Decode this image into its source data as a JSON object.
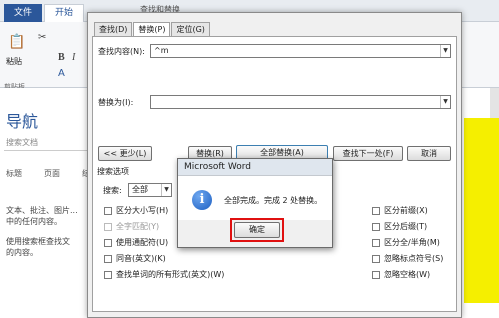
{
  "word": {
    "title_fragment": "查找和替换",
    "tabs": {
      "file": "文件",
      "home": "开始"
    },
    "ribbon_labels": {
      "paste": "粘贴",
      "clipboard": "剪贴板",
      "bold": "B",
      "italic": "I",
      "font_color": "A"
    },
    "nav": {
      "title": "导航",
      "search_placeholder": "搜索文档",
      "tabs": [
        "标题",
        "页面",
        "结"
      ],
      "text1": "文本、批注、图片...\n中的任何内容。",
      "text2": "使用搜索框查找文\n的内容。"
    },
    "colors": {
      "accent": "#2b579a",
      "highlight": "#f5ef00"
    }
  },
  "find_replace": {
    "tabs": [
      "查找(D)",
      "替换(P)",
      "定位(G)"
    ],
    "active_tab": 1,
    "find_label": "查找内容(N):",
    "find_value": "^m",
    "replace_label": "替换为(I):",
    "replace_value": "",
    "buttons": {
      "less": "<< 更少(L)",
      "replace": "替换(R)",
      "replace_all": "全部替换(A)",
      "find_next": "查找下一处(F)",
      "cancel": "取消"
    },
    "search_options_label": "搜索选项",
    "search_label": "搜索:",
    "search_value": "全部",
    "left_options": [
      "区分大小写(H)",
      "全字匹配(Y)",
      "使用通配符(U)",
      "同音(英文)(K)",
      "查找单词的所有形式(英文)(W)"
    ],
    "right_options": [
      "区分前缀(X)",
      "区分后缀(T)",
      "区分全/半角(M)",
      "忽略标点符号(S)",
      "忽略空格(W)"
    ]
  },
  "message_box": {
    "title": "Microsoft Word",
    "message": "全部完成。完成 2 处替换。",
    "ok_label": "确定",
    "icon": "info-icon"
  }
}
